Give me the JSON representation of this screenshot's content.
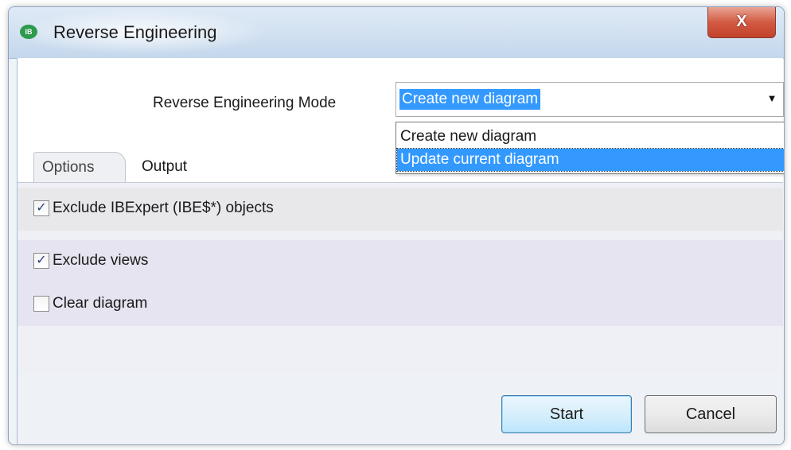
{
  "window": {
    "title": "Reverse Engineering",
    "app_icon_text": "IB",
    "close_glyph": "X"
  },
  "mode": {
    "label": "Reverse Engineering Mode",
    "selected": "Create new diagram",
    "arrow_glyph": "▼",
    "options": [
      {
        "label": "Create new diagram",
        "highlighted": false
      },
      {
        "label": "Update current diagram",
        "highlighted": true
      }
    ]
  },
  "tabs": [
    {
      "label": "Options",
      "active": true
    },
    {
      "label": "Output",
      "active": false
    }
  ],
  "options": [
    {
      "label": "Exclude IBExpert (IBE$*) objects",
      "checked": true,
      "mark": "✓"
    },
    {
      "label": "Exclude views",
      "checked": true,
      "mark": "✓"
    },
    {
      "label": "Clear diagram",
      "checked": false,
      "mark": ""
    }
  ],
  "buttons": {
    "start": "Start",
    "cancel": "Cancel"
  },
  "colors": {
    "selection": "#3399ff",
    "close_button": "#d35a43",
    "app_icon": "#2e9a4e"
  }
}
